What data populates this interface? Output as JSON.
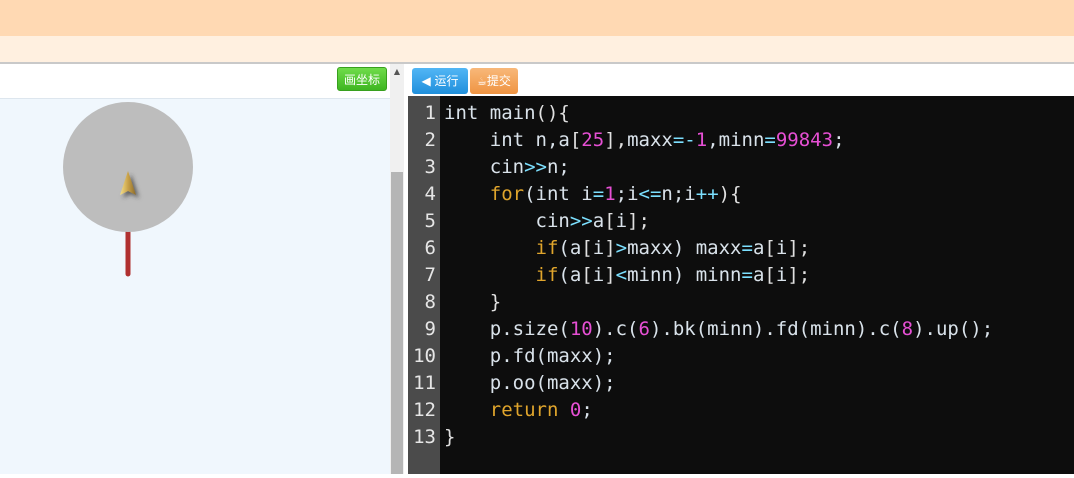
{
  "left_panel": {
    "draw_axis_label": "画坐标"
  },
  "right_panel": {
    "run_label": "◀ 运行",
    "submit_label": "提交"
  },
  "code": {
    "lines": [
      {
        "num": "1",
        "tokens": [
          [
            "int ",
            "p"
          ],
          [
            "main",
            "p"
          ],
          [
            "(){",
            "br"
          ]
        ]
      },
      {
        "num": "2",
        "tokens": [
          [
            "    int n,a",
            "p"
          ],
          [
            "[",
            "br"
          ],
          [
            "25",
            "num"
          ],
          [
            "],",
            "br"
          ],
          [
            "maxx",
            "p"
          ],
          [
            "=-",
            "op"
          ],
          [
            "1",
            "num"
          ],
          [
            ",",
            "p"
          ],
          [
            "minn",
            "p"
          ],
          [
            "=",
            "op"
          ],
          [
            "99843",
            "num"
          ],
          [
            ";",
            "p"
          ]
        ]
      },
      {
        "num": "3",
        "tokens": [
          [
            "    cin",
            "p"
          ],
          [
            ">>",
            "op"
          ],
          [
            "n;",
            "p"
          ]
        ]
      },
      {
        "num": "4",
        "tokens": [
          [
            "    ",
            "p"
          ],
          [
            "for",
            "kw"
          ],
          [
            "(int i",
            "p"
          ],
          [
            "=",
            "op"
          ],
          [
            "1",
            "num"
          ],
          [
            ";i",
            "p"
          ],
          [
            "<=",
            "op"
          ],
          [
            "n;i",
            "p"
          ],
          [
            "++",
            "op"
          ],
          [
            "){",
            "br"
          ]
        ]
      },
      {
        "num": "5",
        "tokens": [
          [
            "        cin",
            "p"
          ],
          [
            ">>",
            "op"
          ],
          [
            "a",
            "p"
          ],
          [
            "[",
            "br"
          ],
          [
            "i",
            "p"
          ],
          [
            "];",
            "br"
          ]
        ]
      },
      {
        "num": "6",
        "tokens": [
          [
            "        ",
            "p"
          ],
          [
            "if",
            "kw"
          ],
          [
            "(a",
            "p"
          ],
          [
            "[",
            "br"
          ],
          [
            "i",
            "p"
          ],
          [
            "]",
            "br"
          ],
          [
            ">",
            "op"
          ],
          [
            "maxx) maxx",
            "p"
          ],
          [
            "=",
            "op"
          ],
          [
            "a",
            "p"
          ],
          [
            "[",
            "br"
          ],
          [
            "i",
            "p"
          ],
          [
            "];",
            "br"
          ]
        ]
      },
      {
        "num": "7",
        "tokens": [
          [
            "        ",
            "p"
          ],
          [
            "if",
            "kw"
          ],
          [
            "(a",
            "p"
          ],
          [
            "[",
            "br"
          ],
          [
            "i",
            "p"
          ],
          [
            "]",
            "br"
          ],
          [
            "<",
            "op"
          ],
          [
            "minn) minn",
            "p"
          ],
          [
            "=",
            "op"
          ],
          [
            "a",
            "p"
          ],
          [
            "[",
            "br"
          ],
          [
            "i",
            "p"
          ],
          [
            "];",
            "br"
          ]
        ]
      },
      {
        "num": "8",
        "tokens": [
          [
            "    }",
            "br"
          ]
        ]
      },
      {
        "num": "9",
        "tokens": [
          [
            "    p.size(",
            "p"
          ],
          [
            "10",
            "num"
          ],
          [
            ").c(",
            "p"
          ],
          [
            "6",
            "num"
          ],
          [
            ").bk(minn).fd(minn).c(",
            "p"
          ],
          [
            "8",
            "num"
          ],
          [
            ").up();",
            "p"
          ]
        ]
      },
      {
        "num": "10",
        "tokens": [
          [
            "    p.fd(maxx);",
            "p"
          ]
        ]
      },
      {
        "num": "11",
        "tokens": [
          [
            "    p.oo(maxx);",
            "p"
          ]
        ]
      },
      {
        "num": "12",
        "tokens": [
          [
            "    ",
            "p"
          ],
          [
            "return",
            "kw"
          ],
          [
            " ",
            "p"
          ],
          [
            "0",
            "num"
          ],
          [
            ";",
            "p"
          ]
        ]
      },
      {
        "num": "13",
        "tokens": [
          [
            "}",
            "br"
          ]
        ]
      }
    ]
  },
  "colors": {
    "header_bg": "#ffd9b3",
    "canvas_bg": "#f0f7fd",
    "editor_bg": "#0d0d0d",
    "gutter_bg": "#4b4b4b",
    "turtle_circle": "#bdbdbd",
    "turtle_line": "#b03030"
  }
}
